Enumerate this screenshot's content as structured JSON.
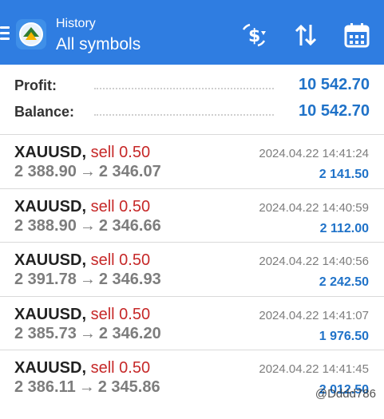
{
  "header": {
    "subtitle": "History",
    "title": "All symbols",
    "icons": [
      "menu-icon",
      "metatrader-logo",
      "currency-filter-icon",
      "sort-icon",
      "calendar-icon"
    ]
  },
  "summary": {
    "profit_label": "Profit:",
    "profit_value": "10 542.70",
    "balance_label": "Balance:",
    "balance_value": "10 542.70"
  },
  "deals": [
    {
      "symbol": "XAUUSD",
      "sep": ",",
      "side": "sell 0.50",
      "open": "2 388.90",
      "arrow": "→",
      "close": "2 346.07",
      "datetime": "2024.04.22 14:41:24",
      "profit": "2 141.50"
    },
    {
      "symbol": "XAUUSD",
      "sep": ",",
      "side": "sell 0.50",
      "open": "2 388.90",
      "arrow": "→",
      "close": "2 346.66",
      "datetime": "2024.04.22 14:40:59",
      "profit": "2 112.00"
    },
    {
      "symbol": "XAUUSD",
      "sep": ",",
      "side": "sell 0.50",
      "open": "2 391.78",
      "arrow": "→",
      "close": "2 346.93",
      "datetime": "2024.04.22 14:40:56",
      "profit": "2 242.50"
    },
    {
      "symbol": "XAUUSD",
      "sep": ",",
      "side": "sell 0.50",
      "open": "2 385.73",
      "arrow": "→",
      "close": "2 346.20",
      "datetime": "2024.04.22 14:41:07",
      "profit": "1 976.50"
    },
    {
      "symbol": "XAUUSD",
      "sep": ",",
      "side": "sell 0.50",
      "open": "2 386.11",
      "arrow": "→",
      "close": "2 345.86",
      "datetime": "2024.04.22 14:41:45",
      "profit": "2 012.50"
    }
  ],
  "watermark": "@Dddd786",
  "colors": {
    "appbar": "#2f7de1",
    "profit": "#1f72c8",
    "sell": "#c62828",
    "muted": "#7d7d7d"
  }
}
